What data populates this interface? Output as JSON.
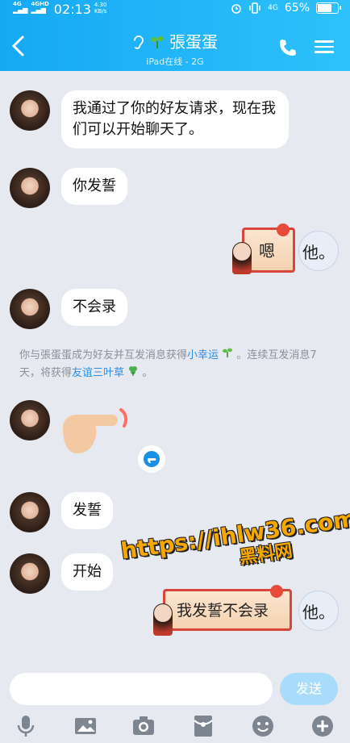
{
  "status": {
    "net1": "4G",
    "net2": "4GHD",
    "time": "02:13",
    "speed_value": "4.30",
    "speed_unit": "KB/s",
    "net3": "4G",
    "battery": "65%",
    "battery_level": 0.65
  },
  "header": {
    "title": "張蛋蛋",
    "subtitle": "iPad在线 - 2G"
  },
  "messages": [
    {
      "text": "我通过了你的好友请求，现在我们可以开始聊天了。"
    },
    {
      "text": "你发誓"
    },
    {
      "sticker_text": "嗯",
      "avatar_text": "他。"
    },
    {
      "text": "不会录"
    },
    {
      "text": "发誓"
    },
    {
      "text": "开始"
    },
    {
      "sticker_text": "我发誓不会录",
      "avatar_text": "他。"
    }
  ],
  "system_notice": {
    "part1": "你与張蛋蛋成为好友并互发消息获得",
    "link1": "小幸运",
    "part2": "。连续互发消息7天，将获得",
    "link2": "友谊三叶草",
    "part3": "。"
  },
  "watermark": {
    "line1": "https://ihlw36.com",
    "line2": "黑料网"
  },
  "composer": {
    "placeholder": "",
    "send_label": "发送"
  },
  "colors": {
    "header_start": "#15a9f4",
    "header_end": "#2fc1fb",
    "background": "#e6e9f0",
    "link": "#2a8de6",
    "send_disabled": "#a9dcfb"
  }
}
